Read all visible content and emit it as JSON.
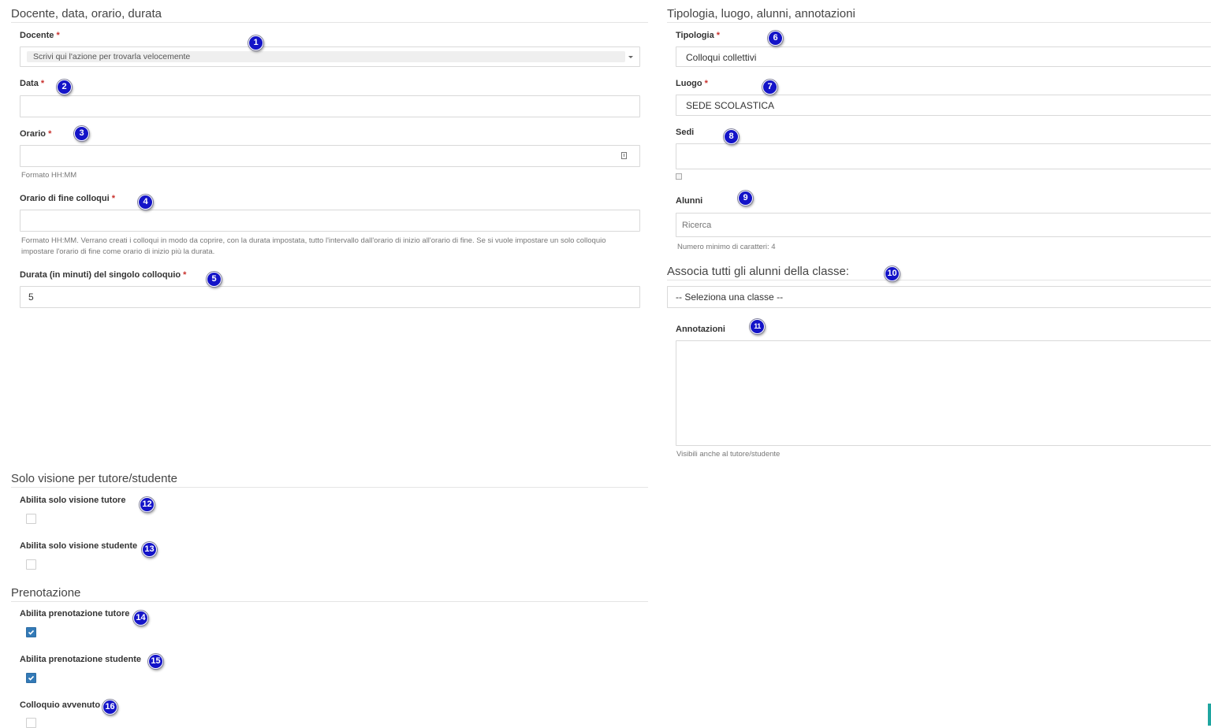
{
  "left": {
    "section1_title": "Docente, data, orario, durata",
    "docente": {
      "label": "Docente",
      "placeholder": "Scrivi qui l'azione per trovarla velocemente"
    },
    "data": {
      "label": "Data",
      "value": ""
    },
    "orario": {
      "label": "Orario",
      "value": "",
      "help": "Formato HH:MM"
    },
    "orario_fine": {
      "label": "Orario di fine colloqui",
      "value": "",
      "help": "Formato HH:MM. Verrano creati i colloqui in modo da coprire, con la durata impostata, tutto l'intervallo dall'orario di inizio all'orario di fine. Se si vuole impostare un solo colloquio impostare l'orario di fine come orario di inizio più la durata."
    },
    "durata": {
      "label": "Durata (in minuti) del singolo colloquio",
      "value": "5"
    },
    "section2_title": "Solo visione per tutore/studente",
    "solo_visione_tutore": {
      "label": "Abilita solo visione tutore",
      "checked": false
    },
    "solo_visione_studente": {
      "label": "Abilita solo visione studente",
      "checked": false
    },
    "section3_title": "Prenotazione",
    "prenotazione_tutore": {
      "label": "Abilita prenotazione tutore",
      "checked": true
    },
    "prenotazione_studente": {
      "label": "Abilita prenotazione studente",
      "checked": true
    },
    "colloquio_avvenuto": {
      "label": "Colloquio avvenuto",
      "checked": false
    }
  },
  "right": {
    "section_title": "Tipologia, luogo, alunni, annotazioni",
    "tipologia": {
      "label": "Tipologia",
      "value": "Colloqui collettivi"
    },
    "luogo": {
      "label": "Luogo",
      "value": "SEDE SCOLASTICA"
    },
    "sedi": {
      "label": "Sedi",
      "value": ""
    },
    "alunni": {
      "label": "Alunni",
      "placeholder": "Ricerca",
      "help": "Numero minimo di caratteri: 4"
    },
    "associa_title": "Associa tutti gli alunni della classe:",
    "classe_select": {
      "value": "-- Seleziona una classe --"
    },
    "annotazioni": {
      "label": "Annotazioni",
      "value": "",
      "help": "Visibili anche al tutore/studente"
    }
  },
  "required_marker": "*",
  "badges": [
    "1",
    "2",
    "3",
    "4",
    "5",
    "6",
    "7",
    "8",
    "9",
    "10",
    "11",
    "12",
    "13",
    "14",
    "15",
    "16"
  ],
  "icons": {
    "clock": "clock-icon",
    "caret": "caret-down-icon",
    "check": "check-icon"
  },
  "colors": {
    "badge": "#1414c8",
    "required": "#c9302c",
    "checkbox_on": "#337ab7"
  }
}
